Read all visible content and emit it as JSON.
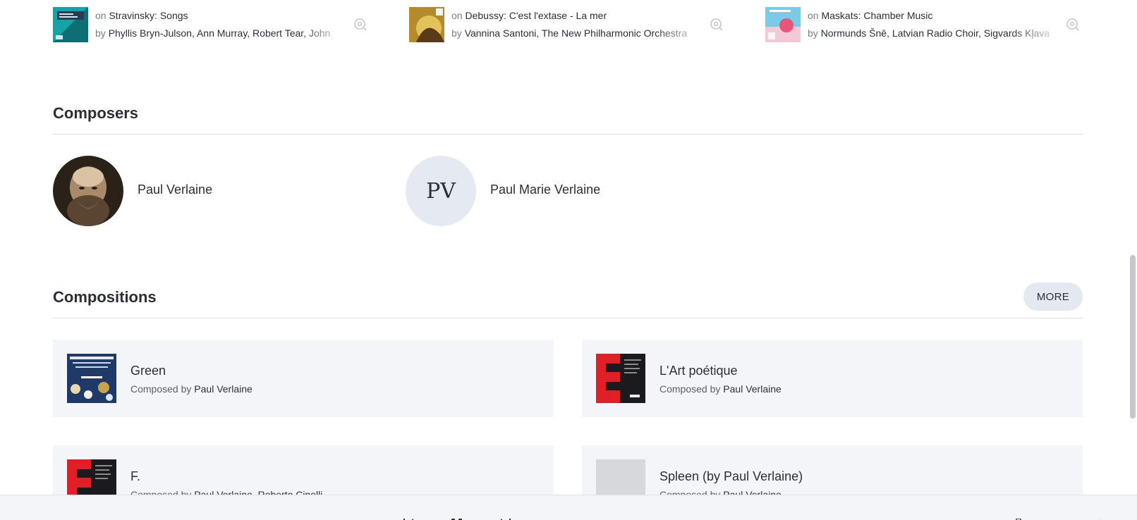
{
  "tracks": [
    {
      "on_prefix": "on",
      "album": "Stravinsky: Songs",
      "by_prefix": "by",
      "artists": "Phyllis Bryn-Julson, Ann Murray, Robert Tear, John",
      "cover_color": "#1aa0a6",
      "icon": "zoom-search-icon"
    },
    {
      "on_prefix": "on",
      "album": "Debussy: C'est l'extase - La mer",
      "by_prefix": "by",
      "artists": "Vannina Santoni, The New Philharmonic Orchestra",
      "cover_color": "#c9a53b",
      "icon": "zoom-search-icon"
    },
    {
      "on_prefix": "on",
      "album": "Maskats: Chamber Music",
      "by_prefix": "by",
      "artists": "Normunds Šnē, Latvian Radio Choir, Sigvards Kļava",
      "cover_color": "#8fd3ea",
      "icon": "zoom-search-icon"
    }
  ],
  "composers_section": {
    "title": "Composers",
    "items": [
      {
        "name": "Paul Verlaine",
        "avatar": "portrait"
      },
      {
        "name": "Paul Marie Verlaine",
        "initials": "PV"
      }
    ]
  },
  "compositions_section": {
    "title": "Compositions",
    "more_label": "MORE",
    "composed_by_prefix": "Composed by",
    "items": [
      {
        "title": "Green",
        "composers": "Paul Verlaine"
      },
      {
        "title": "L'Art poétique",
        "composers": "Paul Verlaine"
      },
      {
        "title": "F.",
        "composers": "Paul Verlaine, Roberto Cipolli"
      },
      {
        "title": "Spleen (by Paul Verlaine)",
        "composers": "Paul Verlaine"
      }
    ]
  },
  "colors": {
    "accent_red": "#e01f26",
    "card_bg": "#f4f5f8",
    "avatar_bg": "#e5e9f1"
  }
}
